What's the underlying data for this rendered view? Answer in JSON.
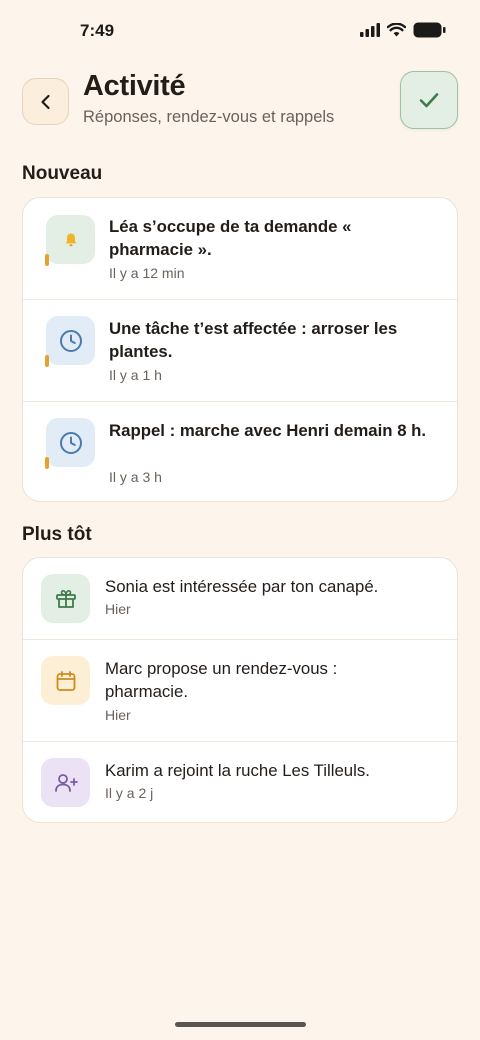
{
  "status_bar": {
    "time": "7:49"
  },
  "header": {
    "title": "Activité",
    "subtitle": "Réponses, rendez-vous et rappels"
  },
  "sections": {
    "new_title": "Nouveau",
    "earlier_title": "Plus tôt"
  },
  "new_items": [
    {
      "text": "Léa s’occupe de ta demande « pharmacie ».",
      "time": "Il y a 12 min",
      "icon": "bell-icon",
      "unread": true
    },
    {
      "text": "Une tâche t’est affectée : arroser les plantes.",
      "time": "Il y a 1 h",
      "icon": "clock-icon",
      "unread": true
    },
    {
      "text": "Rappel : marche avec Henri demain 8 h.",
      "time": "Il y a 3 h",
      "icon": "clock-icon",
      "unread": true
    }
  ],
  "earlier_items": [
    {
      "text": "Sonia est intéressée par ton canapé.",
      "time": "Hier",
      "icon": "gift-icon"
    },
    {
      "text": "Marc propose un rendez-vous : pharmacie.",
      "time": "Hier",
      "icon": "calendar-icon"
    },
    {
      "text": "Karim a rejoint la ruche Les Tilleuls.",
      "time": "Il y a 2 j",
      "icon": "user-plus-icon"
    }
  ],
  "colors": {
    "background": "#fdf5ec",
    "accent_green": "#3f7a4a",
    "unread_dot": "#e6a22e",
    "bell_bg": "#e3efe4",
    "clock_bg": "#e2ecf6",
    "gift_bg": "#e3efe4",
    "calendar_bg": "#fcefd6",
    "user_plus_bg": "#ebe3f5"
  }
}
